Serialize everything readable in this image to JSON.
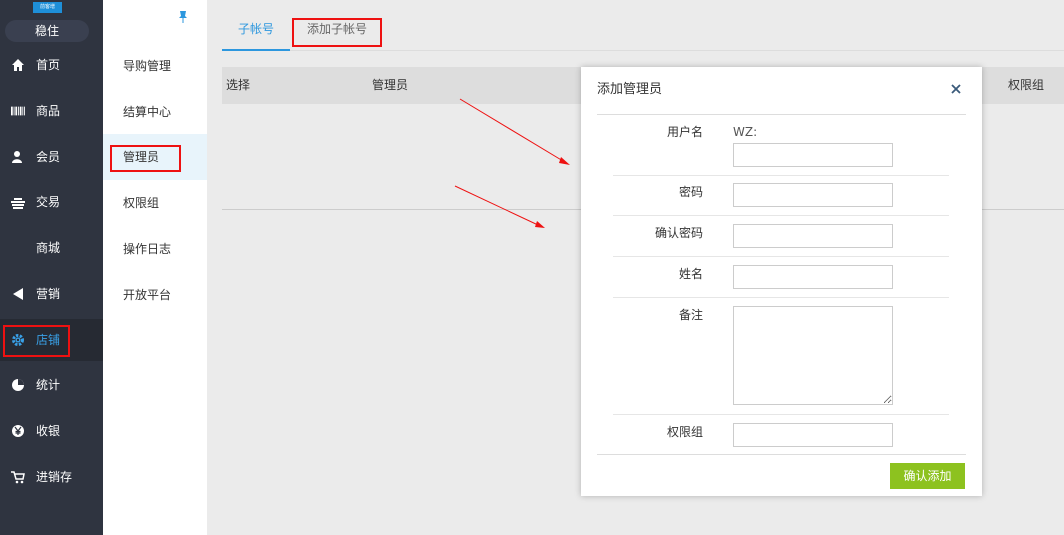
{
  "nav": {
    "badge": "前客增",
    "store_name": "稳住",
    "items": [
      {
        "label": "首页",
        "icon": "home-icon"
      },
      {
        "label": "商品",
        "icon": "barcode-icon"
      },
      {
        "label": "会员",
        "icon": "user-icon"
      },
      {
        "label": "交易",
        "icon": "transaction-icon"
      },
      {
        "label": "商城",
        "icon": ""
      },
      {
        "label": "营销",
        "icon": "megaphone-icon"
      },
      {
        "label": "店铺",
        "icon": "gear-icon"
      },
      {
        "label": "统计",
        "icon": "pie-chart-icon"
      },
      {
        "label": "收银",
        "icon": "yen-icon"
      },
      {
        "label": "进销存",
        "icon": "cart-icon"
      }
    ],
    "active_index": 6
  },
  "submenu": {
    "items": [
      "导购管理",
      "结算中心",
      "管理员",
      "权限组",
      "操作日志",
      "开放平台"
    ],
    "active_index": 2
  },
  "tabs": [
    "子帐号",
    "添加子帐号"
  ],
  "table": {
    "headers": [
      "选择",
      "管理员",
      "权限组"
    ]
  },
  "modal": {
    "title": "添加管理员",
    "fields": {
      "username_label": "用户名",
      "username_prefix": "WZ:",
      "password_label": "密码",
      "confirm_password_label": "确认密码",
      "name_label": "姓名",
      "remark_label": "备注",
      "group_label": "权限组"
    },
    "confirm_button": "确认添加"
  },
  "colors": {
    "nav_bg": "#2f3440",
    "accent": "#2c97de",
    "highlight_red": "#ee1111",
    "confirm_green": "#8dc21f"
  }
}
